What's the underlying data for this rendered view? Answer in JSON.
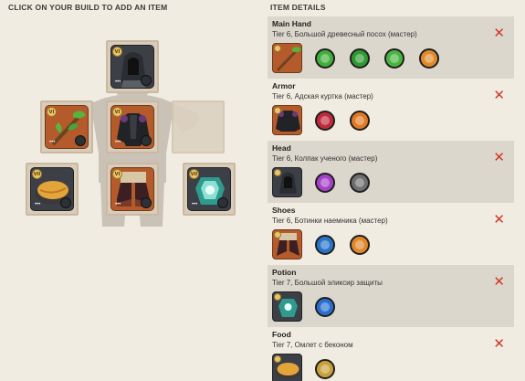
{
  "build": {
    "title": "CLICK ON YOUR BUILD TO ADD AN ITEM"
  },
  "details": {
    "title": "ITEM DETAILS",
    "remove_symbol": "✕",
    "rows": [
      {
        "slot": "Main Hand",
        "item": "Tier 6, Большой древесный посох (мастер)",
        "icon": "great-nature-staff-icon",
        "spells": [
          {
            "icon": "nature-spell-1-icon",
            "color": "#3fae3a"
          },
          {
            "icon": "nature-spell-2-icon",
            "color": "#2f9a31"
          },
          {
            "icon": "nature-spell-3-icon",
            "color": "#49b43f"
          },
          {
            "icon": "passive-orange-icon",
            "color": "#e08a2a"
          }
        ]
      },
      {
        "slot": "Armor",
        "item": "Tier 6, Адская куртка (мастер)",
        "icon": "hellion-jacket-icon",
        "spells": [
          {
            "icon": "red-spell-icon",
            "color": "#c02a3a"
          },
          {
            "icon": "orange-spell-icon",
            "color": "#e07a22"
          }
        ]
      },
      {
        "slot": "Head",
        "item": "Tier 6, Колпак ученого (мастер)",
        "icon": "scholar-cowl-icon",
        "spells": [
          {
            "icon": "purple-spell-icon",
            "color": "#a540c8"
          },
          {
            "icon": "grey-spell-icon",
            "color": "#6f6f6f"
          }
        ]
      },
      {
        "slot": "Shoes",
        "item": "Tier 6, Ботинки наемника (мастер)",
        "icon": "mercenary-shoes-icon",
        "spells": [
          {
            "icon": "blue-spell-icon",
            "color": "#2a74c8"
          },
          {
            "icon": "orange-spell-icon",
            "color": "#e0882a"
          }
        ]
      },
      {
        "slot": "Potion",
        "item": "Tier 7, Большой эликсир защиты",
        "icon": "resistance-potion-icon",
        "spells": [
          {
            "icon": "blue-spell-icon",
            "color": "#2a6fd0"
          }
        ]
      },
      {
        "slot": "Food",
        "item": "Tier 7, Омлет с беконом",
        "icon": "omelette-icon",
        "spells": [
          {
            "icon": "food-buff-icon",
            "color": "#c8a03a"
          }
        ]
      }
    ]
  },
  "slots": {
    "tier_badge": "VI",
    "tier_badge_7": "VII",
    "dots": "•••"
  }
}
